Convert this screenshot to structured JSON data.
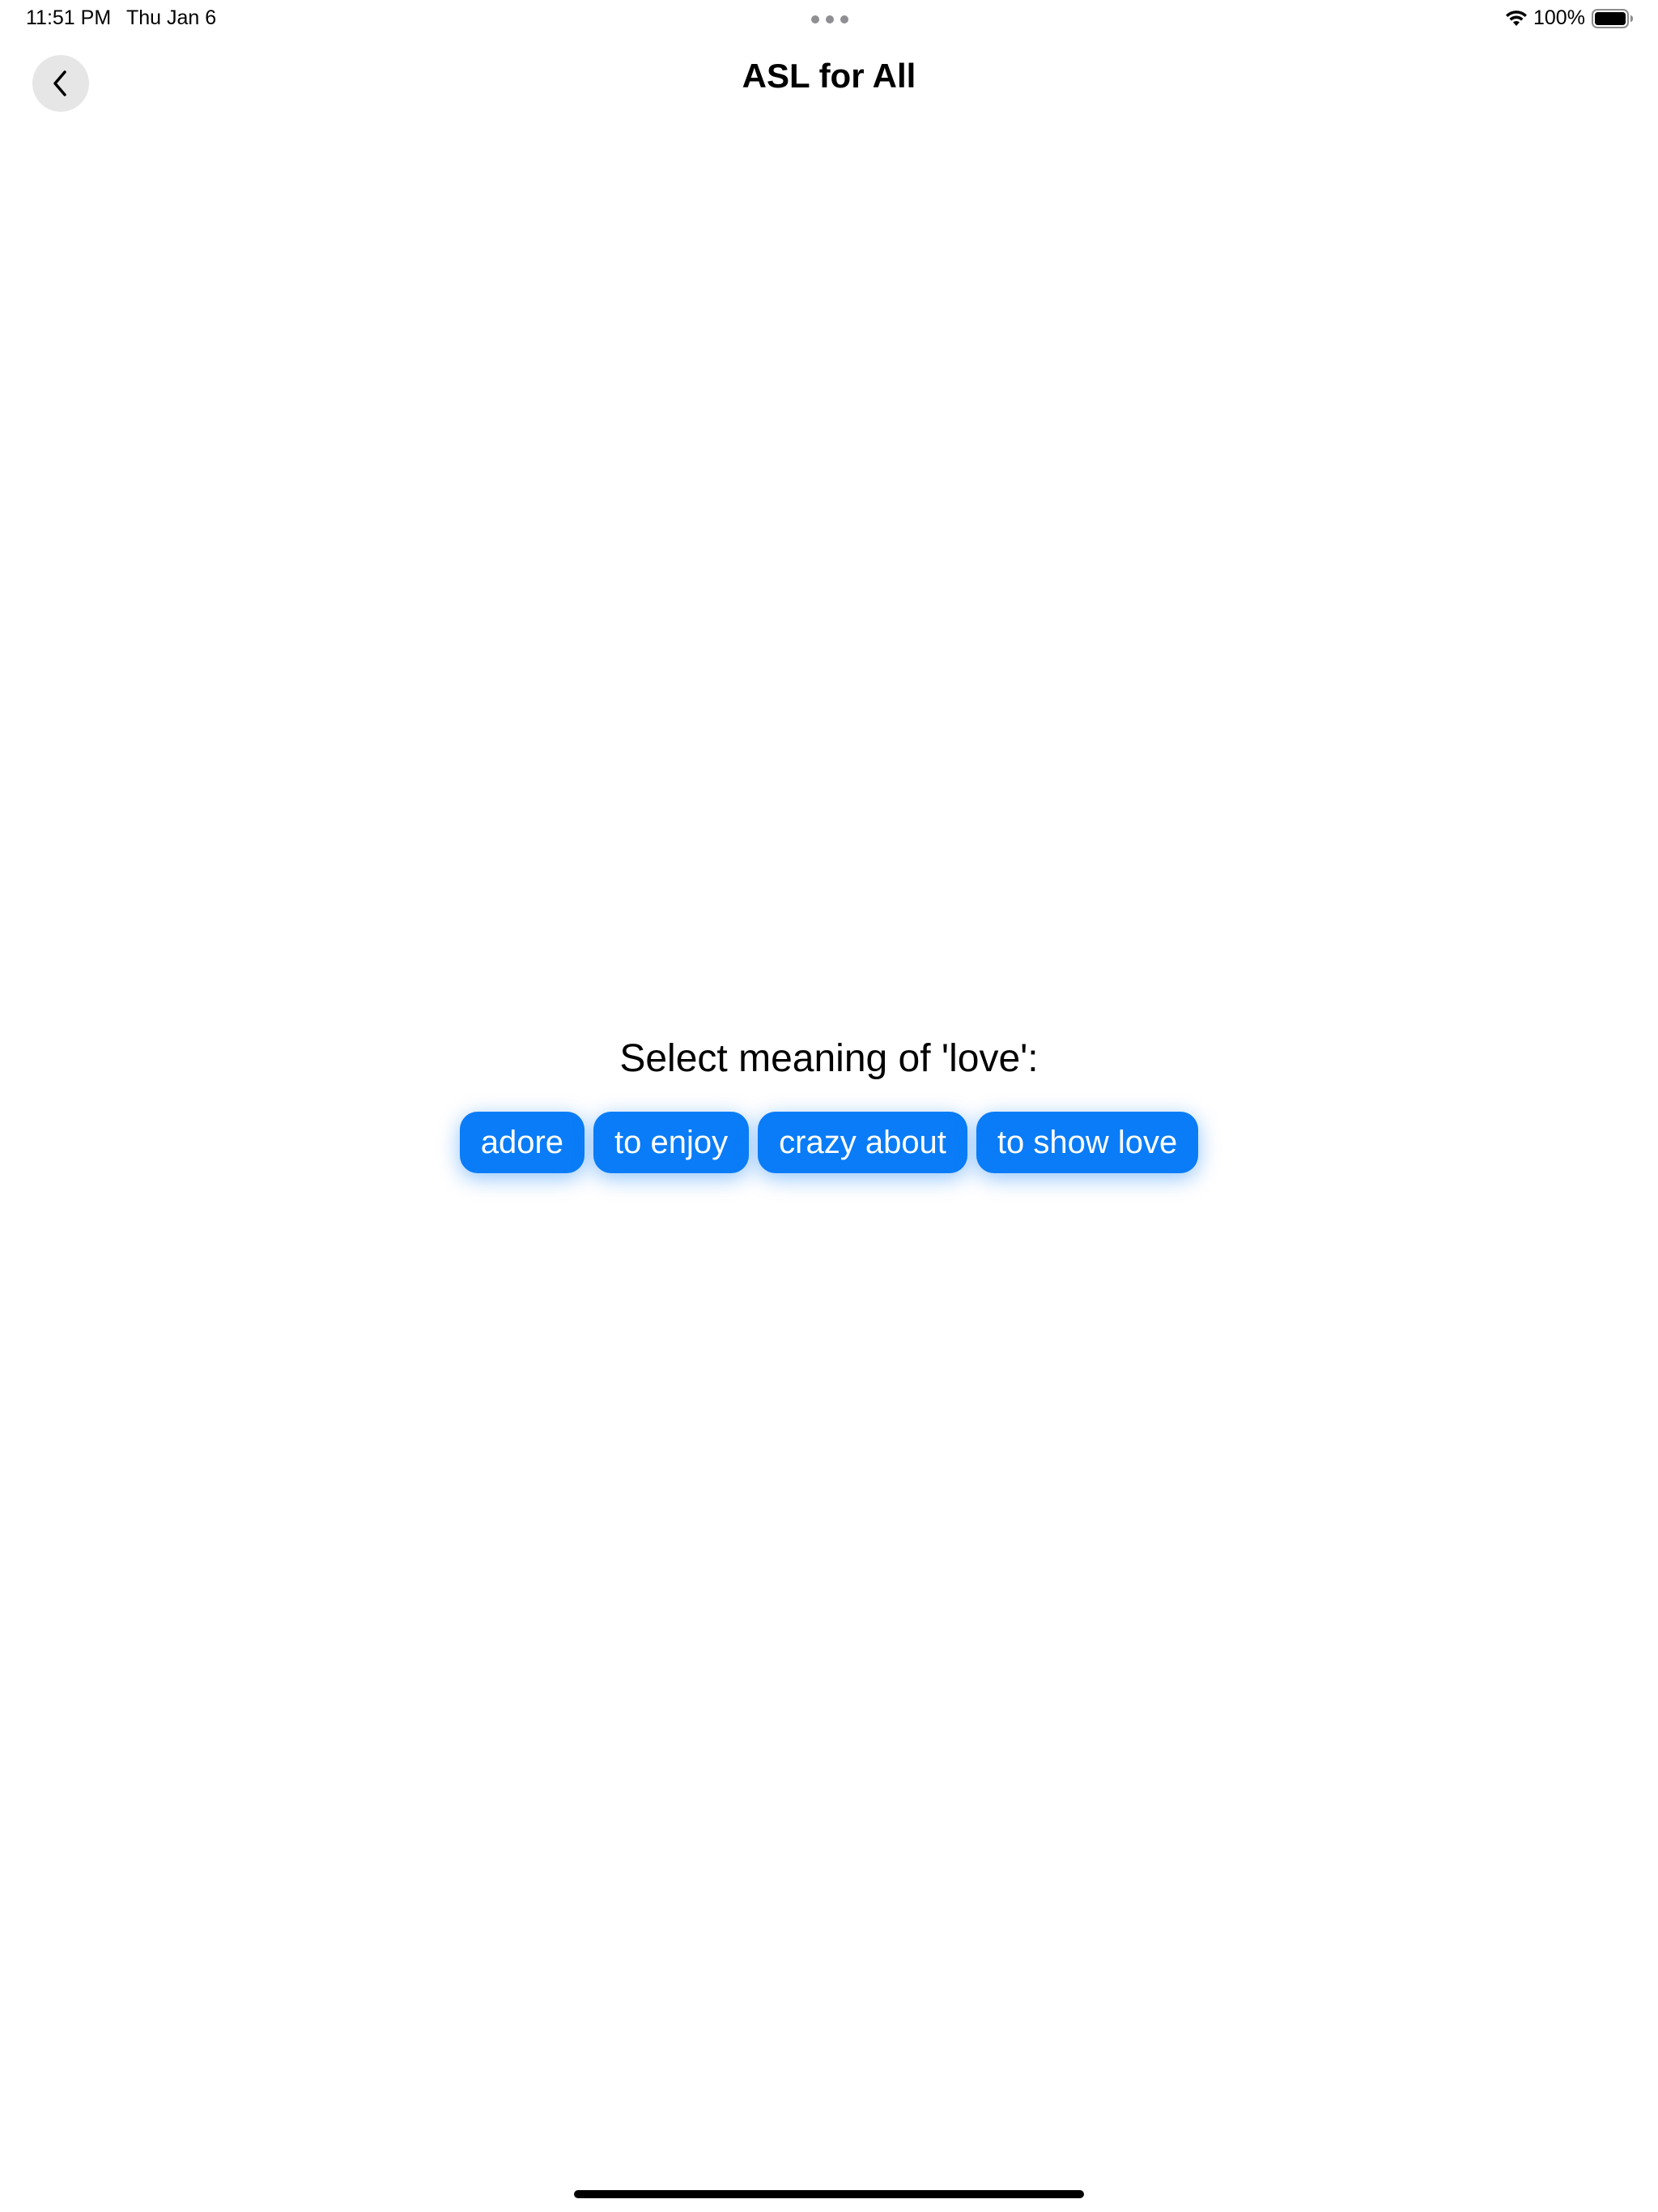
{
  "status_bar": {
    "time": "11:51 PM",
    "date": "Thu Jan 6",
    "battery_percent": "100%",
    "icons": [
      "multitasking-dots-icon",
      "wifi-icon",
      "battery-icon"
    ]
  },
  "nav": {
    "back_icon": "chevron-left-icon",
    "title": "ASL for All"
  },
  "quiz": {
    "prompt": "Select meaning of 'love':",
    "options": [
      "adore",
      "to enjoy",
      "crazy about",
      "to show love"
    ]
  },
  "colors": {
    "accent": "#0a7cf7",
    "back_button_bg": "#e6e6e6",
    "background": "#ffffff"
  }
}
